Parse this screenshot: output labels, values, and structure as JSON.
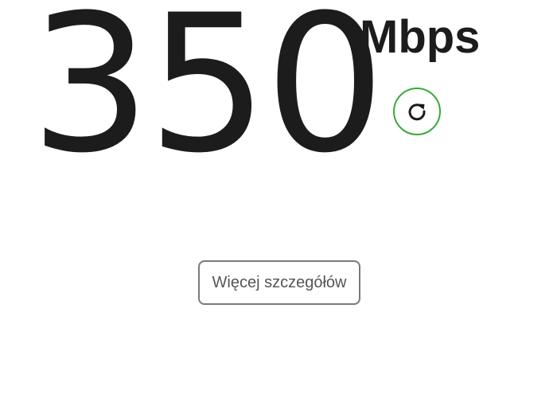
{
  "result": {
    "speed_value": "350",
    "speed_unit": "Mbps"
  },
  "actions": {
    "retest_icon": "refresh-icon",
    "details_label": "Więcej szczegółów"
  },
  "colors": {
    "text": "#1c1c1c",
    "accent_green": "#3aa83a",
    "button_border": "#7a7a7a",
    "button_text": "#555555",
    "background": "#ffffff"
  }
}
